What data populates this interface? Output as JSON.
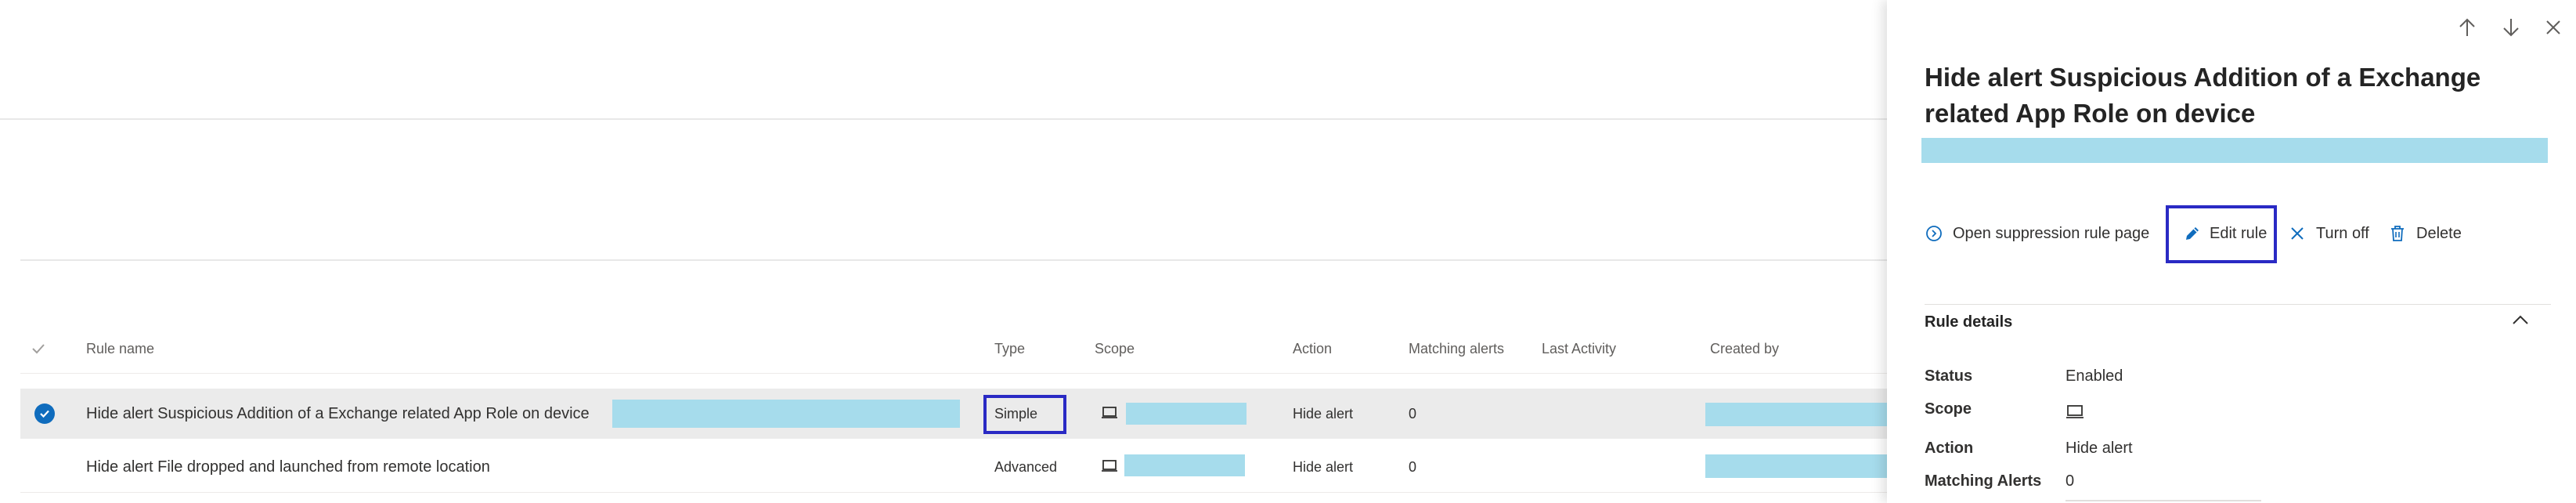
{
  "table": {
    "columns": [
      "Rule name",
      "Type",
      "Scope",
      "Action",
      "Matching alerts",
      "Last Activity",
      "Created by"
    ],
    "rows": [
      {
        "rule_name": "Hide alert Suspicious Addition of a Exchange related App Role on device",
        "type": "Simple",
        "action": "Hide alert",
        "matching_alerts": "0",
        "selected": true
      },
      {
        "rule_name": "Hide alert File dropped and launched from remote location",
        "type": "Advanced",
        "action": "Hide alert",
        "matching_alerts": "0",
        "selected": false
      }
    ]
  },
  "panel": {
    "title": "Hide alert Suspicious Addition of a Exchange related App Role on device",
    "commands": {
      "open_page": "Open suppression rule page",
      "edit": "Edit rule",
      "turn_off": "Turn off",
      "delete": "Delete"
    },
    "details": {
      "section_title": "Rule details",
      "status_label": "Status",
      "status_value": "Enabled",
      "scope_label": "Scope",
      "action_label": "Action",
      "action_value": "Hide alert",
      "matching_label": "Matching Alerts",
      "matching_value": "0"
    },
    "icons": [
      "arrow-up-icon",
      "arrow-down-icon",
      "close-icon"
    ]
  },
  "colors": {
    "accent": "#0f6cbd",
    "highlight_border": "#2a2ac4",
    "redaction": "#a6dcec",
    "selected_row": "#ebebeb"
  }
}
